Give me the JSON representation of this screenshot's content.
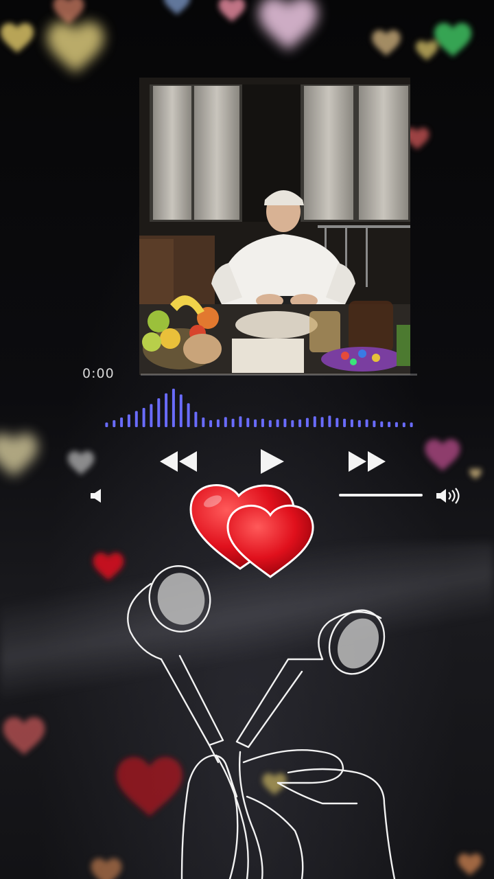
{
  "player": {
    "elapsed_time": "0:00",
    "progress": 0.0,
    "volume": 1.0
  },
  "visualizer": {
    "bar_levels": [
      0.12,
      0.18,
      0.25,
      0.33,
      0.42,
      0.5,
      0.6,
      0.75,
      0.88,
      1.0,
      0.85,
      0.62,
      0.4,
      0.25,
      0.18,
      0.2,
      0.26,
      0.22,
      0.28,
      0.24,
      0.2,
      0.22,
      0.18,
      0.2,
      0.22,
      0.18,
      0.2,
      0.24,
      0.28,
      0.26,
      0.3,
      0.24,
      0.22,
      0.2,
      0.18,
      0.2,
      0.17,
      0.15,
      0.14,
      0.13,
      0.12,
      0.12
    ],
    "color": "#6a6cff"
  },
  "icons": {
    "rewind": "rewind-icon",
    "play": "play-icon",
    "fast_forward": "fast-forward-icon",
    "volume_low": "volume-low-icon",
    "volume_high": "volume-high-icon"
  },
  "colors": {
    "accent_red": "#e0101c",
    "bars": "#6a6cff",
    "control_white": "#f4f4f4"
  }
}
